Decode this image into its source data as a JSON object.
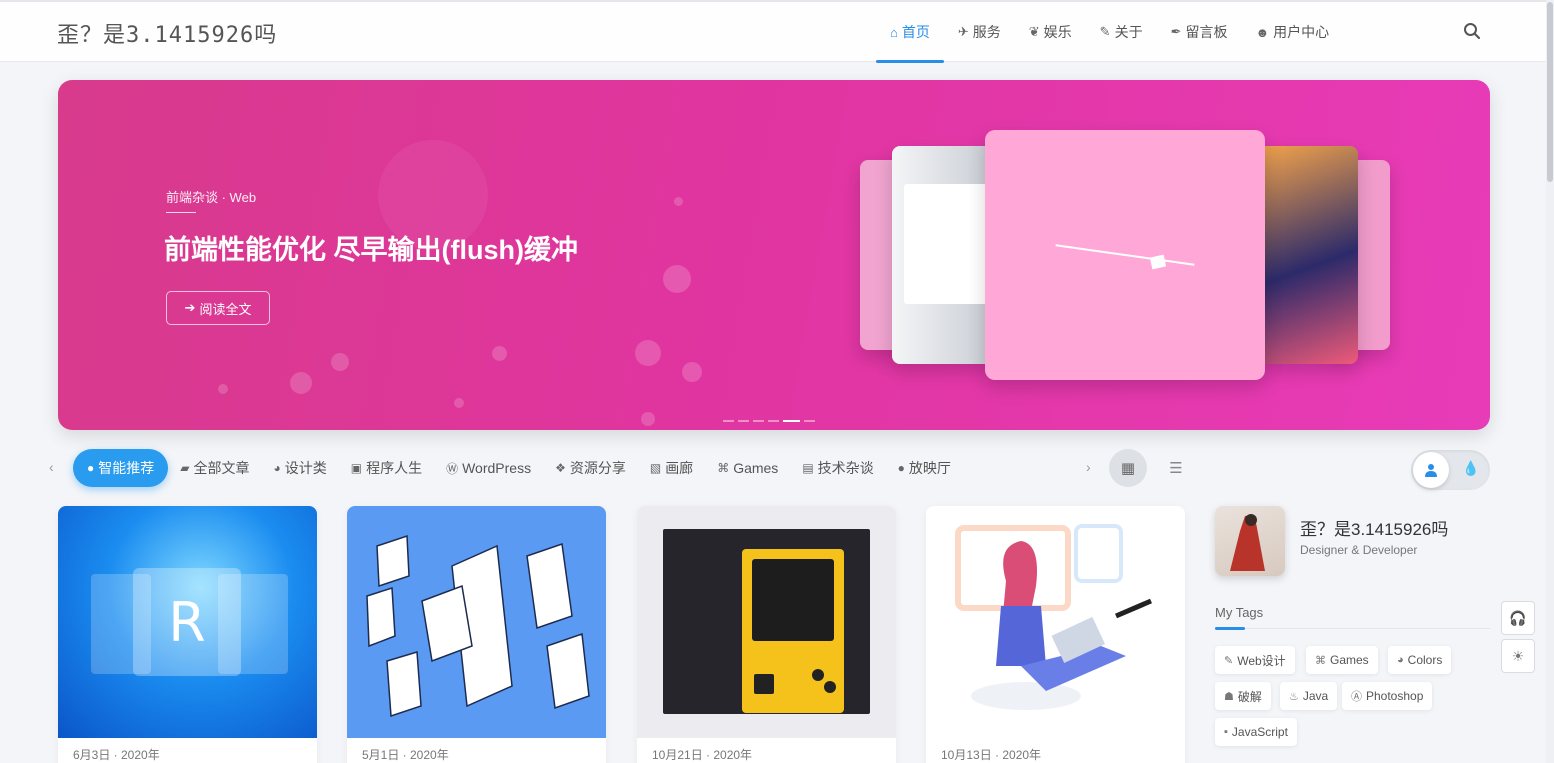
{
  "header": {
    "logo": "歪？是3.1415926吗",
    "nav": [
      {
        "label": "首页",
        "icon": "home-icon",
        "glyph": "⌂",
        "active": true
      },
      {
        "label": "服务",
        "icon": "plane-icon",
        "glyph": "✈",
        "active": false
      },
      {
        "label": "娱乐",
        "icon": "leaf-icon",
        "glyph": "❦",
        "active": false
      },
      {
        "label": "关于",
        "icon": "edit-icon",
        "glyph": "✎",
        "active": false
      },
      {
        "label": "留言板",
        "icon": "pen-icon",
        "glyph": "✒",
        "active": false
      },
      {
        "label": "用户中心",
        "icon": "users-icon",
        "glyph": "☻",
        "active": false
      }
    ],
    "search_icon": "search-icon"
  },
  "banner": {
    "category": "前端杂谈 · Web",
    "title": "前端性能优化 尽早输出(flush)缓冲",
    "button_label": "阅读全文",
    "button_icon": "arrow-right-icon",
    "slides": 6,
    "active_slide": 5,
    "colors": {
      "from": "#d83a8c",
      "to": "#e83bb8"
    }
  },
  "categories": [
    {
      "label": "智能推荐",
      "icon": "bulb-icon",
      "glyph": "💡",
      "active": true
    },
    {
      "label": "全部文章",
      "icon": "folder-icon",
      "glyph": "▰",
      "active": false
    },
    {
      "label": "设计类",
      "icon": "palette-icon",
      "glyph": "◕",
      "active": false
    },
    {
      "label": "程序人生",
      "icon": "monitor-icon",
      "glyph": "▣",
      "active": false
    },
    {
      "label": "WordPress",
      "icon": "wordpress-icon",
      "glyph": "Ⓦ",
      "active": false
    },
    {
      "label": "资源分享",
      "icon": "cubes-icon",
      "glyph": "❖",
      "active": false
    },
    {
      "label": "画廊",
      "icon": "image-icon",
      "glyph": "▧",
      "active": false
    },
    {
      "label": "Games",
      "icon": "gamepad-icon",
      "glyph": "⌘",
      "active": false
    },
    {
      "label": "技术杂谈",
      "icon": "book-icon",
      "glyph": "▤",
      "active": false
    },
    {
      "label": "放映厅",
      "icon": "film-icon",
      "glyph": "●",
      "active": false
    }
  ],
  "view_modes": [
    "grid-view-icon",
    "list-view-icon"
  ],
  "theme_toggle": {
    "light_icon": "user-icon",
    "dark_icon": "drop-icon"
  },
  "posts": [
    {
      "date": "6月3日 · 2020年",
      "thumb": "blue-r-logo-thumb"
    },
    {
      "date": "5月1日 · 2020年",
      "thumb": "isometric-docs-thumb"
    },
    {
      "date": "10月21日 · 2020年",
      "thumb": "retro-gameboy-thumb"
    },
    {
      "date": "10月13日 · 2020年",
      "thumb": "woman-laptop-thumb"
    }
  ],
  "sidebar": {
    "profile_name": "歪？是3.1415926吗",
    "profile_role": "Designer & Developer",
    "tags_title": "My Tags",
    "tags": [
      {
        "label": "Web设计",
        "icon": "brush-icon",
        "glyph": "✎"
      },
      {
        "label": "Games",
        "icon": "gamepad-icon",
        "glyph": "⌘"
      },
      {
        "label": "Colors",
        "icon": "palette-icon",
        "glyph": "◕"
      },
      {
        "label": "破解",
        "icon": "user-secret-icon",
        "glyph": "☗"
      },
      {
        "label": "Java",
        "icon": "java-icon",
        "glyph": "♨"
      },
      {
        "label": "Photoshop",
        "icon": "adobe-icon",
        "glyph": "Ⓐ"
      },
      {
        "label": "JavaScript",
        "icon": "js-icon",
        "glyph": "▪"
      }
    ]
  },
  "floating": [
    "headset-icon",
    "sun-icon"
  ],
  "accent": "#2a8de8"
}
